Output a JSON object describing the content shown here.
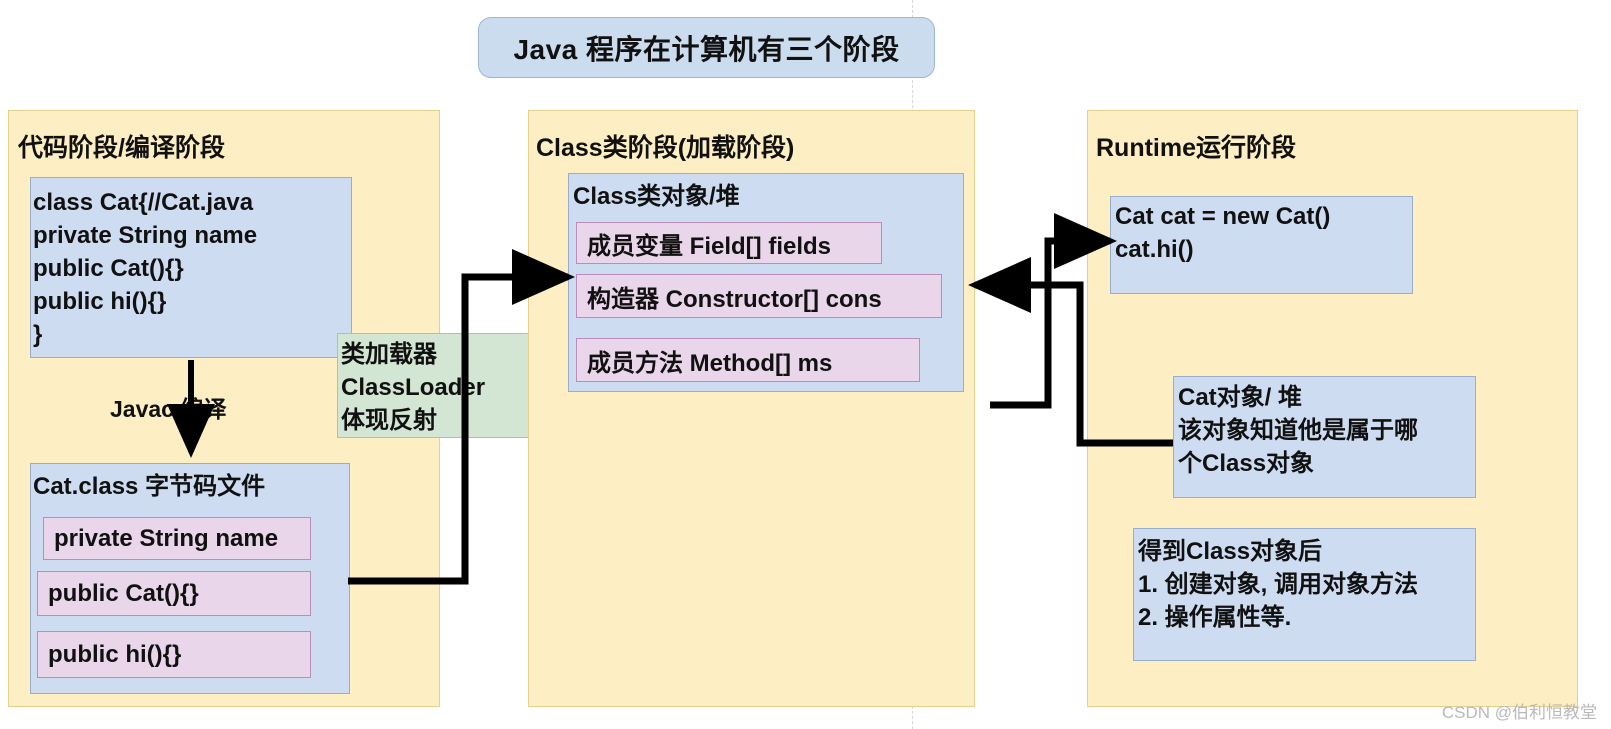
{
  "title": {
    "text": "Java 程序在计算机有三个阶段"
  },
  "stages": [
    {
      "id": "compile",
      "title": "代码阶段/编译阶段"
    },
    {
      "id": "class-load",
      "title": "Class类阶段(加载阶段)"
    },
    {
      "id": "runtime",
      "title": "Runtime运行阶段"
    }
  ],
  "compile_stage": {
    "source_box": {
      "text": "class Cat{//Cat.java\nprivate String name\npublic Cat(){}\npublic hi(){}\n}"
    },
    "javac_label": "Javac 编译",
    "class_file_box": {
      "heading": "Cat.class 字节码文件",
      "members": [
        "private String name",
        "public Cat(){}",
        "public hi(){}"
      ]
    }
  },
  "classloader_box": {
    "text": "类加载器\nClassLoader\n体现反射"
  },
  "class_stage": {
    "heap_box": {
      "heading": "Class类对象/堆",
      "members": [
        "成员变量 Field[] fields",
        "构造器 Constructor[] cons",
        "成员方法 Method[] ms"
      ]
    }
  },
  "runtime_stage": {
    "code_box": {
      "text": "Cat cat = new Cat()\ncat.hi()"
    },
    "object_box": {
      "text": "Cat对象/ 堆\n该对象知道他是属于哪\n个Class对象"
    },
    "usage_box": {
      "text": "得到Class对象后\n1. 创建对象, 调用对象方法\n2. 操作属性等."
    }
  },
  "watermark": {
    "text": "CSDN @伯利恒教堂"
  },
  "colors": {
    "stage_fill": "#fdeec4",
    "stage_border": "#e3cf8e",
    "blue_fill": "#cddcf1",
    "blue_border": "#9aaecb",
    "pink_fill": "#e9d6ea",
    "pink_border": "#b98fb9",
    "green_fill": "#d3e6d3",
    "green_border": "#a9c4a9",
    "title_fill": "#ccdcef",
    "connector": "#000000"
  }
}
